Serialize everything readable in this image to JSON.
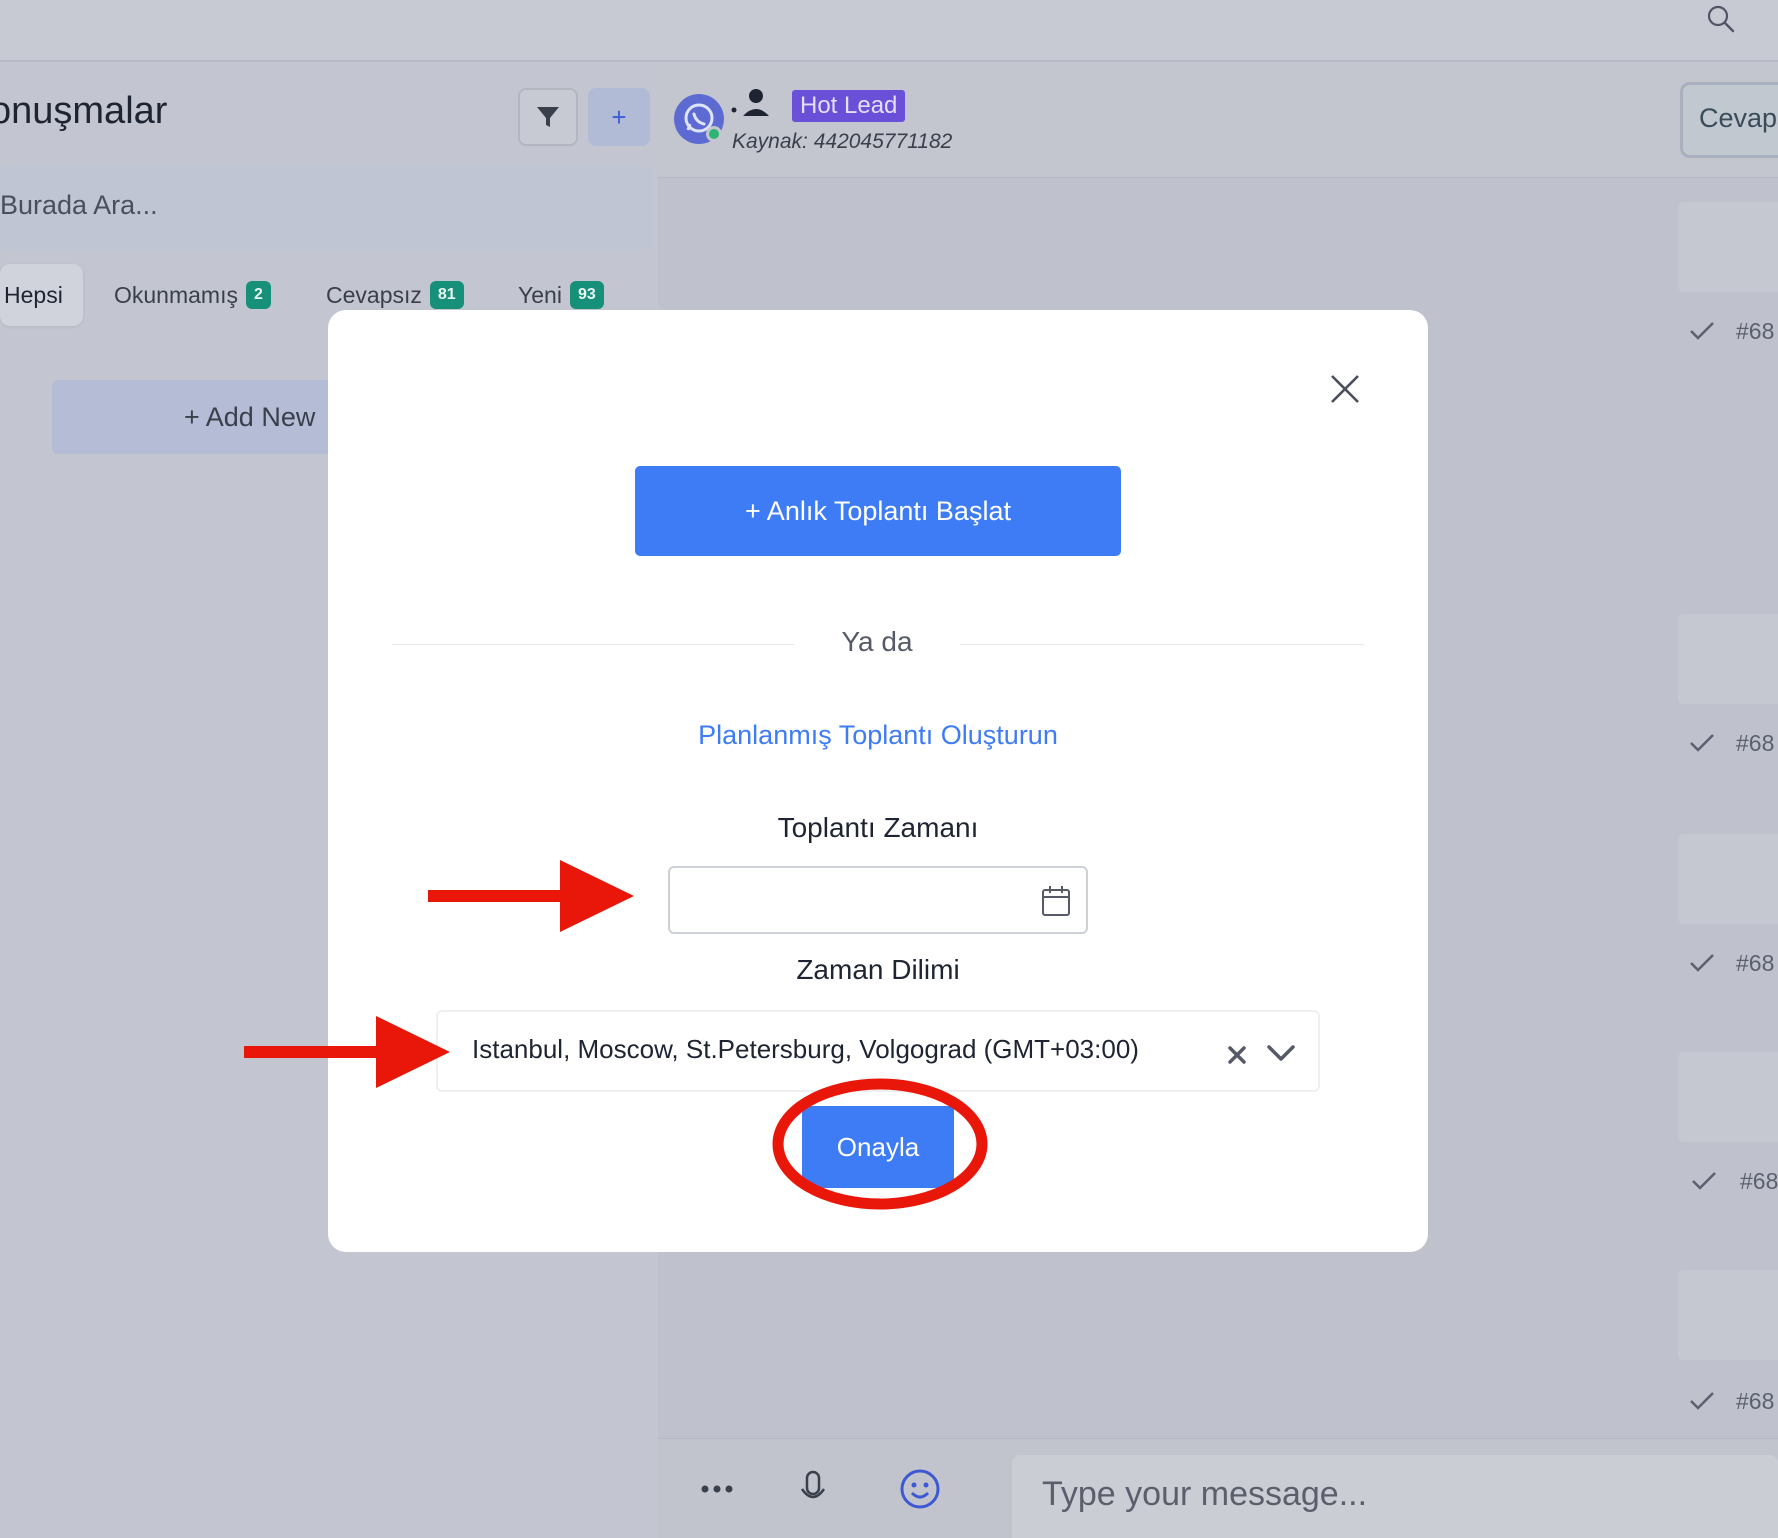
{
  "sidebar": {
    "title": "onuşmalar",
    "search_placeholder": "Burada Ara...",
    "tabs": [
      {
        "label": "Hepsi",
        "count": ""
      },
      {
        "label": "Okunmamış",
        "count": "2"
      },
      {
        "label": "Cevapsız",
        "count": "81"
      },
      {
        "label": "Yeni",
        "count": "93"
      }
    ],
    "add_new_label": "+  Add New"
  },
  "chat": {
    "tag": "Hot Lead",
    "source": "Kaynak: 442045771182",
    "reply_button": "Cevaps",
    "message_ids": [
      "#68",
      "#68",
      "#68",
      "#68",
      "#68"
    ],
    "composer_placeholder": "Type your message..."
  },
  "modal": {
    "start_button": "+  Anlık Toplantı Başlat",
    "or_text": "Ya da",
    "planned_link": "Planlanmış Toplantı Oluşturun",
    "time_label": "Toplantı Zamanı",
    "time_value": "",
    "timezone_label": "Zaman Dilimi",
    "timezone_value": "Istanbul, Moscow, St.Petersburg, Volgograd (GMT+03:00)",
    "confirm_button": "Onayla"
  },
  "colors": {
    "primary": "#3e7cf5",
    "badge": "#17907a",
    "hot_lead": "#6a4fd8",
    "annotation_red": "#e8170a"
  },
  "icons": [
    "search-icon",
    "filter-icon",
    "plus-icon",
    "whatsapp-icon",
    "person-icon",
    "check-icon",
    "close-icon",
    "calendar-icon",
    "clear-icon",
    "chevron-down-icon",
    "more-icon",
    "microphone-icon",
    "emoji-icon"
  ]
}
